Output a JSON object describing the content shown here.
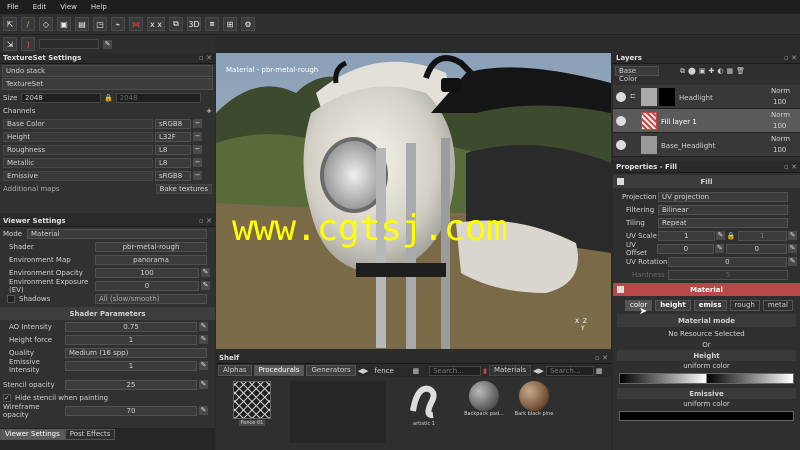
{
  "menu": [
    "File",
    "Edit",
    "View",
    "Help"
  ],
  "toolbar": {
    "icons": [
      "cursor-icon",
      "brush-icon",
      "eraser-icon",
      "projection-icon",
      "smudge-icon",
      "clone-icon",
      "picker-icon",
      "symmetry-icon",
      "mirror-icon",
      "camera-icon",
      "render-icon",
      "export-icon",
      "sync-icon",
      "settings-icon"
    ],
    "xx_label": "x x",
    "d3_label": "3D"
  },
  "textureset": {
    "title": "TextureSet Settings",
    "undo": "Undo stack",
    "textureset": "TextureSet",
    "size_label": "Size",
    "size_value": "2048",
    "size_value2": "2048",
    "channels_label": "Channels",
    "channels": [
      {
        "name": "Base Color",
        "format": "sRGB8"
      },
      {
        "name": "Height",
        "format": "L32F"
      },
      {
        "name": "Roughness",
        "format": "L8"
      },
      {
        "name": "Metallic",
        "format": "L8"
      },
      {
        "name": "Emissive",
        "format": "sRGB8"
      }
    ],
    "additional": "Additional maps",
    "bake": "Bake textures"
  },
  "viewer": {
    "title": "Viewer Settings",
    "mode_label": "Mode",
    "mode_value": "Material",
    "shader_label": "Shader",
    "shader_value": "pbr-metal-rough",
    "envmap_label": "Environment Map",
    "envmap_value": "panorama",
    "envop_label": "Environment Opacity",
    "envop_value": "100",
    "envexp_label": "Environment Exposure (EV)",
    "envexp_value": "0",
    "shadows_label": "Shadows",
    "shadows_value": "All (slow/smooth)",
    "shader_params": "Shader Parameters",
    "ao_label": "AO Intensity",
    "ao_value": "0.75",
    "height_force_label": "Height force",
    "height_force_value": "1",
    "quality_label": "Quality",
    "quality_value": "Medium (16 spp)",
    "emissive_label": "Emissive Intensity",
    "emissive_value": "1",
    "stencil_label": "Stencil opacity",
    "stencil_value": "25",
    "hide_stencil": "Hide stencil when painting",
    "wire_label": "Wireframe opacity",
    "wire_value": "70"
  },
  "bottom_tabs": [
    "Viewer Settings",
    "Post Effects"
  ],
  "viewport": {
    "label": "Material - pbr-metal-rough",
    "watermark": "www.cgtsj.com",
    "axis": "X   Z\n   Y"
  },
  "shelf": {
    "title": "Shelf",
    "tabs": [
      "Alphas",
      "Procedurals",
      "Generators"
    ],
    "active_tab": "Procedurals",
    "filter": "fence",
    "search_placeholder": "Search...",
    "materials_tab": "Materials",
    "items": [
      {
        "name": "Fence 01"
      },
      {
        "name": "artistic 1"
      },
      {
        "name": "Backpack pad..."
      },
      {
        "name": "Bark black pine"
      }
    ]
  },
  "layers": {
    "title": "Layers",
    "mode": "Base Color",
    "rows": [
      {
        "name": "Headlight",
        "blend": "Norm",
        "opacity": "100"
      },
      {
        "name": "Fill layer 1",
        "blend": "Norm",
        "opacity": "100"
      },
      {
        "name": "Base_Headlight",
        "blend": "Norm",
        "opacity": "100"
      }
    ]
  },
  "properties": {
    "title": "Properties - Fill",
    "fill_header": "Fill",
    "projection_label": "Projection",
    "projection_value": "UV projection",
    "filtering_label": "Filtering",
    "filtering_value": "Bilinear",
    "tiling_label": "Tiling",
    "tiling_value": "Repeat",
    "uvscale_label": "UV Scale",
    "uvscale_value": "1",
    "uvscale_value2": "1",
    "uvoffset_label": "UV Offset",
    "uvoffset_value": "0",
    "uvoffset_value2": "0",
    "uvrot_label": "UV Rotation",
    "uvrot_value": "0",
    "hardness_label": "Hardness",
    "hardness_value": "5",
    "material_header": "Material",
    "mat_tabs": [
      "color",
      "height",
      "emiss",
      "rough",
      "metal"
    ],
    "mat_mode": "Material mode",
    "no_resource": "No Resource Selected",
    "or": "Or",
    "height_header": "Height",
    "uniform1": "uniform color",
    "emissive_header": "Emissive",
    "uniform2": "uniform color"
  }
}
